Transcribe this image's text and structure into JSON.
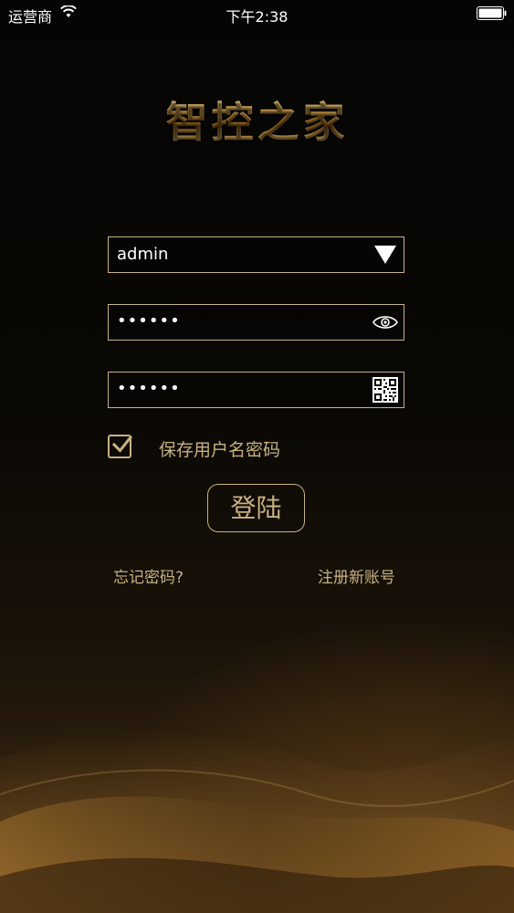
{
  "status_bar": {
    "carrier": "运营商",
    "time": "下午2:38"
  },
  "app": {
    "title": "智控之家"
  },
  "form": {
    "username": {
      "value": "admin",
      "icon": "dropdown-triangle-icon"
    },
    "password": {
      "value": "••••••",
      "icon": "eye-icon"
    },
    "code": {
      "value": "••••••",
      "icon": "qr-code-icon"
    },
    "save_credentials": {
      "label": "保存用户名密码",
      "checked": true
    },
    "login_label": "登陆",
    "forgot_label": "忘记密码?",
    "register_label": "注册新账号"
  },
  "colors": {
    "accent": "#c8b27e",
    "background": "#050505"
  }
}
